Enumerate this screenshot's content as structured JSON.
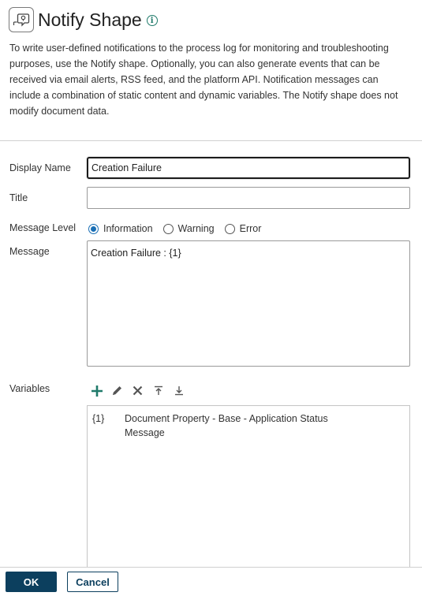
{
  "dialog": {
    "title": "Notify Shape",
    "description": "To write user-defined notifications to the process log for monitoring and troubleshooting purposes, use the Notify shape. Optionally, you can also generate events that can be received via email alerts, RSS feed, and the platform API. Notification messages can include a combination of static content and dynamic variables. The Notify shape does not modify document data."
  },
  "form": {
    "display_name_label": "Display Name",
    "display_name_value": "Creation Failure",
    "title_label": "Title",
    "title_value": "",
    "message_level_label": "Message Level",
    "message_levels": [
      "Information",
      "Warning",
      "Error"
    ],
    "message_level_selected": "Information",
    "message_label": "Message",
    "message_value": "Creation Failure : {1}",
    "variables_label": "Variables"
  },
  "variables": [
    {
      "index": "{1}",
      "description": "Document Property - Base - Application Status Message"
    }
  ],
  "toolbar": {
    "icons": [
      "add-icon",
      "edit-icon",
      "delete-icon",
      "move-up-icon",
      "move-down-icon"
    ]
  },
  "buttons": {
    "ok": "OK",
    "cancel": "Cancel"
  },
  "colors": {
    "accent": "#0c3f5e",
    "teal": "#1f7a6a",
    "radio": "#1a6fb5"
  }
}
